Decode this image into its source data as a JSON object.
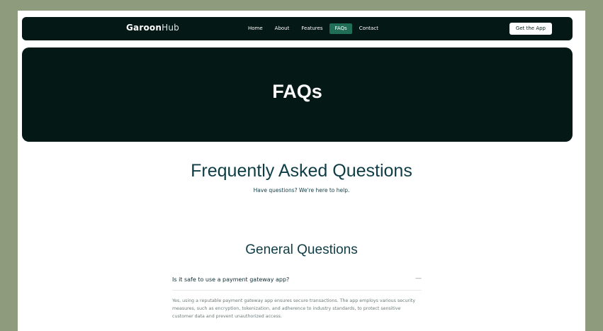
{
  "nav": {
    "brand_primary": "Garoon",
    "brand_secondary": "Hub",
    "links": [
      "Home",
      "About",
      "Features",
      "FAQs",
      "Contact"
    ],
    "active_link": "FAQs",
    "cta_label": "Get the App"
  },
  "hero": {
    "title": "FAQs"
  },
  "intro": {
    "title": "Frequently Asked Questions",
    "subtitle": "Have questions? We're here to help."
  },
  "general": {
    "title": "General Questions",
    "items": [
      {
        "question": "Is it safe to use a payment gateway app?",
        "toggle_symbol": "—",
        "answer": "Yes, using a reputable payment gateway app ensures secure transactions. The app employs various security measures, such as encryption, tokenization, and adherence to industry standards, to protect sensitive customer data and prevent unauthorized access."
      }
    ]
  },
  "colors": {
    "background": "#8f9b7d",
    "dark_panel": "#041815",
    "accent": "#1f6e55",
    "heading_text": "#0f3d45"
  }
}
